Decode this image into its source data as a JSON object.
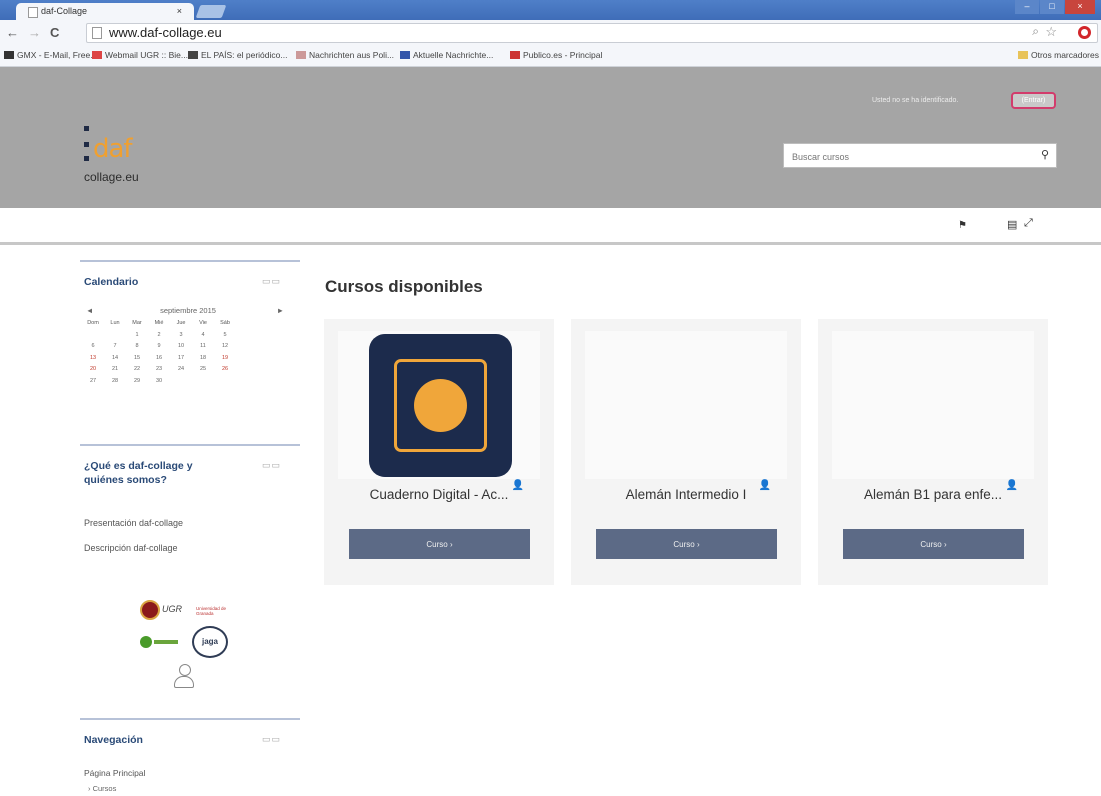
{
  "browser": {
    "tab_title": "daf-Collage",
    "tab_close": "×",
    "url": "www.daf-collage.eu",
    "bookmarks": [
      "GMX - E-Mail, Free...",
      "Webmail UGR :: Bie...",
      "EL PAÍS: el periódico...",
      "Nachrichten aus Poli...",
      "Aktuelle Nachrichte...",
      "Publico.es - Principal"
    ],
    "other_bookmarks": "Otros marcadores"
  },
  "header": {
    "logo_text": "daf",
    "logo_sub": "collage.eu",
    "login_text": "Usted no se ha identificado.",
    "login_button": "(Entrar)",
    "search_placeholder": "Buscar cursos"
  },
  "sidebar": {
    "calendar": {
      "title": "Calendario",
      "month": "septiembre 2015",
      "prev": "◄",
      "next": "►",
      "weekdays": [
        "Dom",
        "Lun",
        "Mar",
        "Mié",
        "Jue",
        "Vie",
        "Sáb"
      ],
      "weeks": [
        [
          "",
          "",
          "1",
          "2",
          "3",
          "4",
          "5"
        ],
        [
          "6",
          "7",
          "8",
          "9",
          "10",
          "11",
          "12"
        ],
        [
          "13",
          "14",
          "15",
          "16",
          "17",
          "18",
          "19"
        ],
        [
          "20",
          "21",
          "22",
          "23",
          "24",
          "25",
          "26"
        ],
        [
          "27",
          "28",
          "29",
          "30",
          "",
          "",
          ""
        ]
      ]
    },
    "about": {
      "title_line1": "¿Qué es daf-collage y",
      "title_line2": "quiénes somos?",
      "links": [
        "Presentación daf-collage",
        "Descripción daf-collage"
      ]
    },
    "partner_logos": {
      "ugr": "UGR",
      "ugr_name": "Universidad de Granada",
      "jaga": "jaga"
    },
    "navigation": {
      "title": "Navegación",
      "home": "Página Principal",
      "courses": "Cursos"
    },
    "block_controls": "▭▭"
  },
  "main": {
    "title": "Cursos disponibles",
    "courses": [
      {
        "title": "Cuaderno Digital - Ac...",
        "button": "Curso ›"
      },
      {
        "title": "Alemán Intermedio I",
        "button": "Curso ›"
      },
      {
        "title": "Alemán B1 para enfe...",
        "button": "Curso ›"
      }
    ]
  },
  "colors": {
    "header_bg": "#a5a5a5",
    "accent_orange": "#f0a63a",
    "button_bg": "#5c6a86",
    "app_icon_bg": "#1c2b4c"
  }
}
